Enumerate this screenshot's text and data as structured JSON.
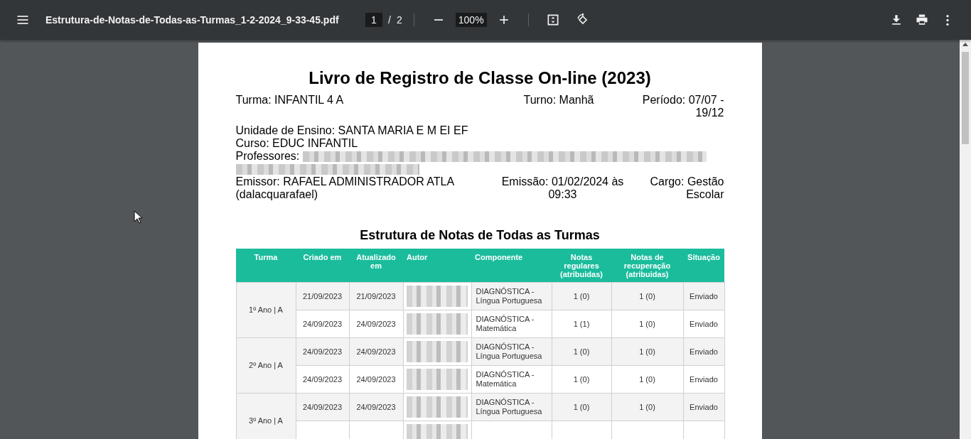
{
  "viewer": {
    "filename": "Estrutura-de-Notas-de-Todas-as-Turmas_1-2-2024_9-33-45.pdf",
    "page": "1",
    "page_separator": "/",
    "page_total": "2",
    "zoom": "100%"
  },
  "document": {
    "title": "Livro de Registro de Classe On-line (2023)",
    "turma": "Turma: INFANTIL 4 A",
    "turno": "Turno: Manhã",
    "periodo": "Período: 07/07 - 19/12",
    "unidade": "Unidade de Ensino: SANTA MARIA E M EI EF",
    "curso": "Curso: EDUC INFANTIL",
    "professores_label": "Professores:",
    "emissor": "Emissor: RAFAEL ADMINISTRADOR ATLA (dalacquarafael)",
    "emissao": "Emissão: 01/02/2024 às 09:33",
    "cargo": "Cargo: Gestão Escolar",
    "section_title": "Estrutura de Notas de Todas as Turmas",
    "table": {
      "columns": [
        "Turma",
        "Criado em",
        "Atualizado em",
        "Autor",
        "Componente",
        "Notas regulares (atribuidas)",
        "Notas de recuperação (atribuidas)",
        "Situação"
      ],
      "groups": [
        {
          "turma": "1º Ano | A",
          "rows": [
            {
              "criado": "21/09/2023",
              "atualizado": "21/09/2023",
              "componente": "DIAGNÓSTICA - Língua Portuguesa",
              "notas_regulares": "1 (0)",
              "notas_recuperacao": "1 (0)",
              "situacao": "Enviado"
            },
            {
              "criado": "24/09/2023",
              "atualizado": "24/09/2023",
              "componente": "DIAGNÓSTICA - Matemática",
              "notas_regulares": "1 (1)",
              "notas_recuperacao": "1 (0)",
              "situacao": "Enviado"
            }
          ]
        },
        {
          "turma": "2º Ano | A",
          "rows": [
            {
              "criado": "24/09/2023",
              "atualizado": "24/09/2023",
              "componente": "DIAGNÓSTICA - Língua Portuguesa",
              "notas_regulares": "1 (0)",
              "notas_recuperacao": "1 (0)",
              "situacao": "Enviado"
            },
            {
              "criado": "24/09/2023",
              "atualizado": "24/09/2023",
              "componente": "DIAGNÓSTICA - Matemática",
              "notas_regulares": "1 (0)",
              "notas_recuperacao": "1 (0)",
              "situacao": "Enviado"
            }
          ]
        },
        {
          "turma": "3º Ano | A",
          "rows": [
            {
              "criado": "24/09/2023",
              "atualizado": "24/09/2023",
              "componente": "DIAGNÓSTICA - Língua Portuguesa",
              "notas_regulares": "1 (0)",
              "notas_recuperacao": "1 (0)",
              "situacao": "Enviado"
            }
          ]
        }
      ]
    }
  }
}
